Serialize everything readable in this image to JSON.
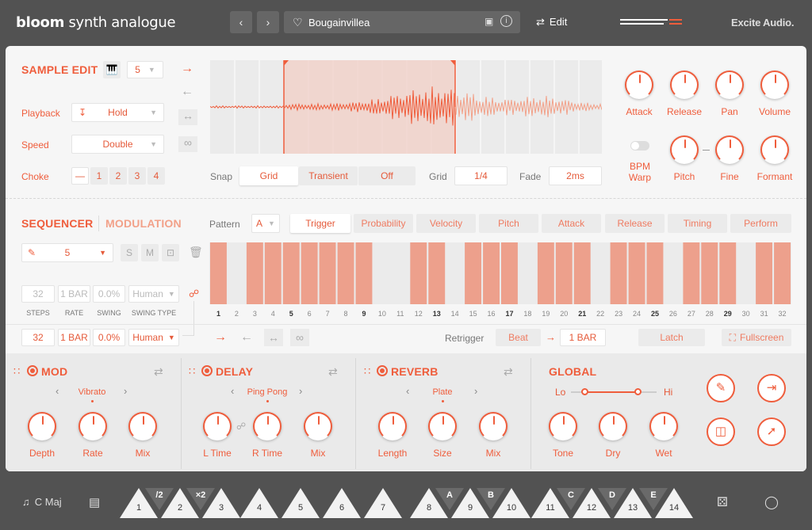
{
  "header": {
    "logo_bold": "bloom",
    "logo_rest": "synth analogue",
    "preset_name": "Bougainvillea",
    "edit_label": "Edit",
    "brand": "Excite Audio."
  },
  "sample_edit": {
    "title": "SAMPLE EDIT",
    "voice_count": "5",
    "playback_label": "Playback",
    "playback_value": "Hold",
    "speed_label": "Speed",
    "speed_value": "Double",
    "choke_label": "Choke",
    "choke_options": [
      "—",
      "1",
      "2",
      "3",
      "4"
    ],
    "snap_label": "Snap",
    "snap_options": [
      "Grid",
      "Transient",
      "Off"
    ],
    "grid_label": "Grid",
    "grid_value": "1/4",
    "fade_label": "Fade",
    "fade_value": "2ms",
    "knobs_top": [
      "Attack",
      "Release",
      "Pan",
      "Volume"
    ],
    "bpm_warp": "BPM\nWarp",
    "knobs_bottom": [
      "Pitch",
      "Fine",
      "Formant"
    ]
  },
  "sequencer": {
    "title": "SEQUENCER",
    "modulation_tab": "MODULATION",
    "pattern_label": "Pattern",
    "pattern_value": "A",
    "tabs": [
      "Trigger",
      "Probability",
      "Velocity",
      "Pitch",
      "Attack",
      "Release",
      "Timing",
      "Perform"
    ],
    "slot_value": "5",
    "s_label": "S",
    "m_label": "M",
    "params_top": [
      "32",
      "1 BAR",
      "0.0%",
      "Human"
    ],
    "params_labels": [
      "STEPS",
      "RATE",
      "SWING",
      "SWING TYPE"
    ],
    "params_bottom": [
      "32",
      "1 BAR",
      "0.0%",
      "Human"
    ],
    "steps": [
      true,
      false,
      true,
      true,
      true,
      true,
      true,
      true,
      true,
      false,
      false,
      true,
      true,
      false,
      true,
      true,
      true,
      false,
      true,
      true,
      true,
      false,
      true,
      true,
      true,
      false,
      true,
      true,
      true,
      false,
      true,
      true
    ],
    "retrigger_label": "Retrigger",
    "retrigger_value": "Beat",
    "retrigger_rate": "1 BAR",
    "latch_label": "Latch",
    "fullscreen_label": "Fullscreen"
  },
  "fx": {
    "mod": {
      "title": "MOD",
      "type": "Vibrato",
      "knobs": [
        "Depth",
        "Rate",
        "Mix"
      ]
    },
    "delay": {
      "title": "DELAY",
      "type": "Ping Pong",
      "knobs": [
        "L Time",
        "R Time",
        "Mix"
      ]
    },
    "reverb": {
      "title": "REVERB",
      "type": "Plate",
      "knobs": [
        "Length",
        "Size",
        "Mix"
      ]
    },
    "global": {
      "title": "GLOBAL",
      "lo": "Lo",
      "hi": "Hi",
      "knobs": [
        "Tone",
        "Dry",
        "Wet"
      ]
    }
  },
  "footer": {
    "key_label": "C Maj",
    "keys": [
      "1",
      "2",
      "3",
      "4",
      "5",
      "6",
      "7",
      "8",
      "9",
      "10",
      "11",
      "12",
      "13",
      "14"
    ],
    "key_tags": [
      "/2",
      "×2",
      "",
      "",
      "",
      "",
      "",
      "A",
      "B",
      "",
      "C",
      "D",
      "E"
    ]
  },
  "colors": {
    "accent": "#ef5d3c",
    "light_accent": "#f2a189",
    "bg_dark": "#525252"
  }
}
